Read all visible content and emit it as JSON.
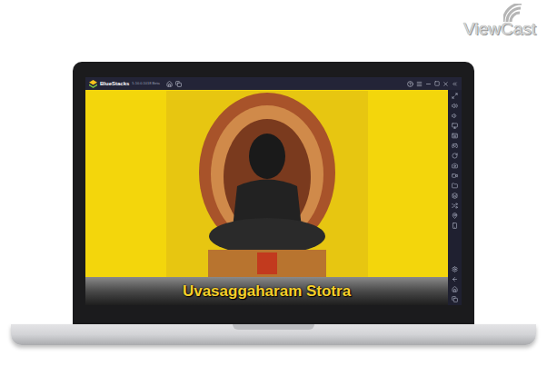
{
  "watermark": {
    "text": "ViewCast"
  },
  "window": {
    "title": "BlueStacks",
    "version": "5.10.0.1018 Beta"
  },
  "app": {
    "caption": "Uvasaggaharam Stotra"
  }
}
